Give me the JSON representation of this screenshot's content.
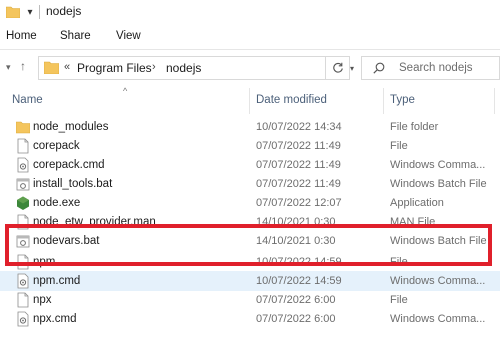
{
  "window": {
    "title": "nodejs",
    "quick_access": "▾"
  },
  "ribbon": {
    "tabs": [
      "Home",
      "Share",
      "View"
    ]
  },
  "address": {
    "overflow": "«",
    "crumbs": [
      "Program Files",
      "nodejs"
    ],
    "separator": "›"
  },
  "search": {
    "placeholder": "Search nodejs"
  },
  "columns": {
    "name": "Name",
    "date": "Date modified",
    "type": "Type"
  },
  "files": [
    {
      "name": "node_modules",
      "date": "10/07/2022 14:34",
      "type": "File folder",
      "icon": "folder-icon"
    },
    {
      "name": "corepack",
      "date": "07/07/2022 11:49",
      "type": "File",
      "icon": "file-icon"
    },
    {
      "name": "corepack.cmd",
      "date": "07/07/2022 11:49",
      "type": "Windows Comma...",
      "icon": "cmd-file-icon"
    },
    {
      "name": "install_tools.bat",
      "date": "07/07/2022 11:49",
      "type": "Windows Batch File",
      "icon": "bat-file-icon"
    },
    {
      "name": "node.exe",
      "date": "07/07/2022 12:07",
      "type": "Application",
      "icon": "node-exe-icon"
    },
    {
      "name": "node_etw_provider.man",
      "date": "14/10/2021 0:30",
      "type": "MAN File",
      "icon": "file-icon"
    },
    {
      "name": "nodevars.bat",
      "date": "14/10/2021 0:30",
      "type": "Windows Batch File",
      "icon": "bat-file-icon"
    },
    {
      "name": "npm",
      "date": "10/07/2022 14:59",
      "type": "File",
      "icon": "file-icon"
    },
    {
      "name": "npm.cmd",
      "date": "10/07/2022 14:59",
      "type": "Windows Comma...",
      "icon": "cmd-file-icon"
    },
    {
      "name": "npx",
      "date": "07/07/2022 6:00",
      "type": "File",
      "icon": "file-icon"
    },
    {
      "name": "npx.cmd",
      "date": "07/07/2022 6:00",
      "type": "Windows Comma...",
      "icon": "cmd-file-icon"
    }
  ],
  "colors": {
    "folder": "#f4c55d",
    "selection": "#e5f1fb",
    "highlight_box": "#e0202b",
    "node_green": "#3c873a"
  }
}
